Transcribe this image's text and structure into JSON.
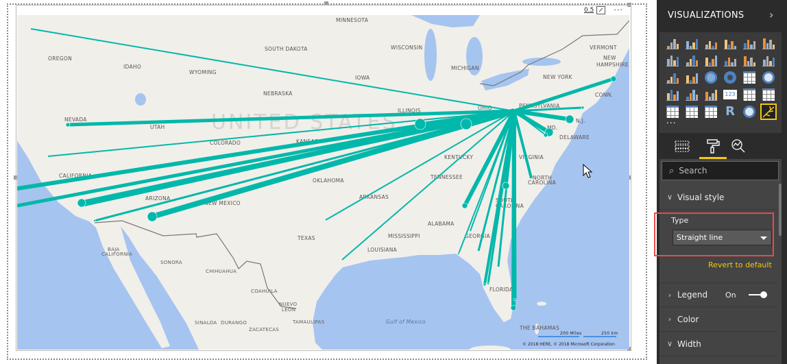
{
  "visual": {
    "zoom_readout": "0.5",
    "more_options": "···",
    "attribution": "© 2018 HERE, © 2018 Microsoft Corporation",
    "scale_miles": "200 Miles",
    "scale_km": "250 km",
    "country_label": "UNITED STATES",
    "sea_label": "Gulf of Mexico",
    "state_labels": [
      "MINNESOTA",
      "SOUTH DAKOTA",
      "WISCONSIN",
      "OREGON",
      "IDAHO",
      "WYOMING",
      "MICHIGAN",
      "IOWA",
      "NEBRASKA",
      "NEW YORK",
      "VERMONT",
      "NEW",
      "HAMPSHIRE",
      "CONN.",
      "PENNSYLVANIA",
      "OHIO",
      "ILLINOIS",
      "NEVADA",
      "UTAH",
      "COLORADO",
      "KANSAS",
      "CALIFORNIA",
      "KENTUCKY",
      "VIRGINIA",
      "MD.",
      "N.J.",
      "DELAWARE",
      "OKLAHOMA",
      "ARIZONA",
      "NEW MEXICO",
      "ARKANSAS",
      "TENNESSEE",
      "NORTH",
      "CAROLINA",
      "SOUTH",
      "CAROLINA",
      "ALABAMA",
      "MISSISSIPPI",
      "GEORGIA",
      "TEXAS",
      "LOUISIANA",
      "FLORIDA",
      "THE BAHAMAS"
    ],
    "mexico_labels": [
      "BAJA",
      "CALIFORNIA",
      "SONORA",
      "CHIHUAHUA",
      "COAHUILA",
      "NUEVO",
      "LEÓN",
      "TAMAULIPAS",
      "SINALOA",
      "DURANGO",
      "ZACATECAS"
    ],
    "flow_color": "#01b8aa",
    "land_color": "#f1efe9",
    "water_color": "#a6c4f0"
  },
  "panel": {
    "title": "VISUALIZATIONS",
    "expand_icon": "chevron-right-icon",
    "more": "...",
    "viz_icons": [
      "stacked-bar",
      "stacked-column",
      "clustered-bar",
      "clustered-column",
      "100-stacked-bar",
      "100-stacked-column",
      "line",
      "area",
      "stacked-area",
      "line-stacked-column",
      "line-clustered-column",
      "ribbon",
      "waterfall",
      "scatter",
      "pie",
      "donut",
      "treemap",
      "map",
      "filled-map",
      "funnel",
      "gauge",
      "card",
      "multi-row-card",
      "kpi",
      "slicer",
      "table",
      "matrix",
      "r-script",
      "globe-map",
      "flow-map"
    ],
    "selected_viz": "flow-map",
    "tabs": [
      "fields-icon",
      "format-paint-roller-icon",
      "analytics-icon"
    ],
    "active_tab": "format",
    "accent": "#f2c811",
    "search_placeholder": "Search",
    "visual_style": {
      "label": "Visual style",
      "type_label": "Type",
      "type_value": "Straight line",
      "revert": "Revert to default"
    },
    "legend": {
      "label": "Legend",
      "state": "On",
      "on": true
    },
    "color": {
      "label": "Color"
    },
    "width": {
      "label": "Width"
    }
  }
}
